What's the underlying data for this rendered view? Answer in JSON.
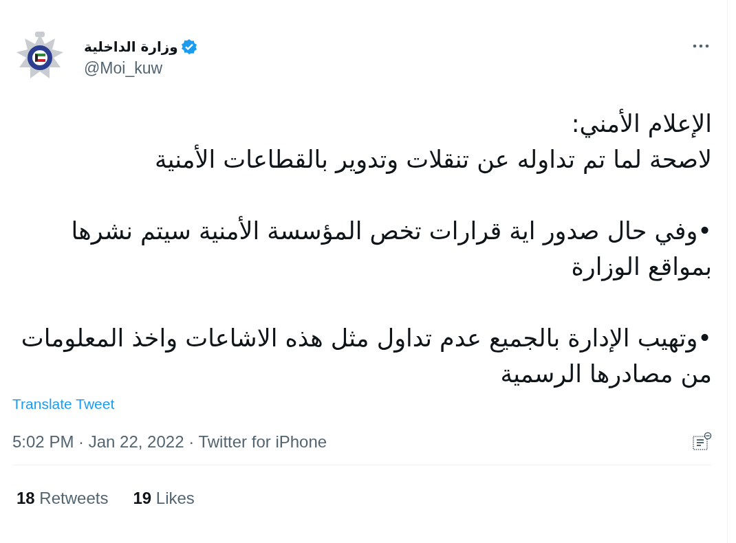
{
  "tweet": {
    "author": {
      "name": "وزارة الداخلية",
      "verified": true,
      "handle": "@Moi_kuw"
    },
    "paragraphs": [
      {
        "lines": [
          "الإعلام الأمني:",
          "لاصحة لما تم تداوله عن تنقلات وتدوير بالقطاعات الأمنية"
        ]
      },
      {
        "lines": [
          "•وفي حال صدور اية قرارات تخص المؤسسة الأمنية سيتم نشرها بمواقع الوزارة"
        ]
      },
      {
        "lines": [
          "•وتهيب الإدارة بالجميع عدم تداول مثل هذه الاشاعات واخذ المعلومات من مصادرها الرسمية"
        ]
      }
    ],
    "translate": "Translate Tweet",
    "meta": "5:02 PM · Jan 22, 2022 · Twitter for iPhone",
    "retweets": {
      "count": "18",
      "label": "Retweets"
    },
    "likes": {
      "count": "19",
      "label": "Likes"
    }
  }
}
